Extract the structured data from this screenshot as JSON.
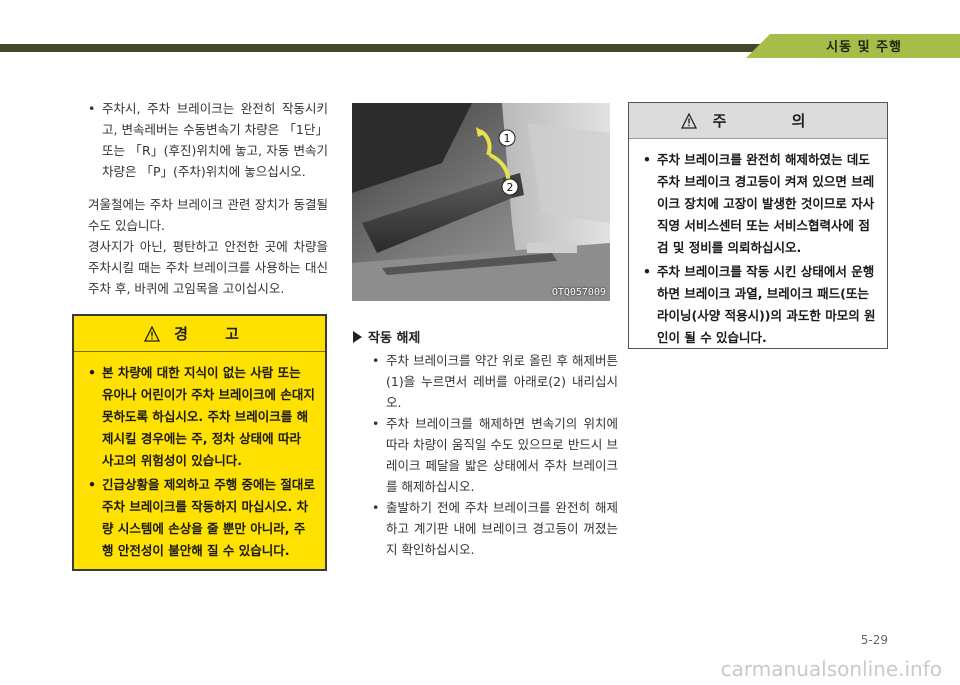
{
  "header": {
    "section_title": "시동 및 주행"
  },
  "left_column": {
    "bullet_parking": "주차시, 주차 브레이크는 완전히 작동시키고, 변속레버는 수동변속기 차량은 「1단」 또는 「R」(후진)위치에 놓고, 자동 변속기차량은 「P」(주차)위치에 놓으십시오.",
    "para_winter": "겨울철에는 주차 브레이크 관련 장치가 동결될 수도 있습니다.",
    "para_slope": "경사지가 아닌, 평탄하고 안전한 곳에 차량을 주차시킬 때는 주차 브레이크를 사용하는 대신 주차 후, 바퀴에 고임목을 고이십시오."
  },
  "warning_box": {
    "title": "경 고",
    "items": [
      "본 차량에 대한 지식이 없는 사람 또는 유아나 어린이가 주차 브레이크에 손대지 못하도록 하십시오. 주차 브레이크를 해제시킬 경우에는 주, 정차 상태에 따라 사고의 위험성이 있습니다.",
      "긴급상황을 제외하고 주행 중에는 절대로 주차 브레이크를 작동하지 마십시오. 차량 시스템에 손상을 줄 뿐만 아니라, 주행 안전성이 불안해 질 수 있습니다."
    ]
  },
  "photo": {
    "code": "OTQ057009",
    "callout_1": "1",
    "callout_2": "2"
  },
  "release_section": {
    "heading": "작동 해제",
    "items": [
      "주차 브레이크를 약간 위로 올린 후 해제버튼(1)을 누르면서 레버를 아래로(2) 내리십시오.",
      "주차 브레이크를 해제하면 변속기의 위치에 따라 차량이 움직일 수도 있으므로 반드시 브레이크 페달을 밟은 상태에서 주차 브레이크를 해제하십시오.",
      "출발하기 전에 주차 브레이크를 완전히 해제하고 계기판 내에 브레이크 경고등이 꺼졌는지 확인하십시오."
    ]
  },
  "caution_box": {
    "title": "주 의",
    "items": [
      "주차 브레이크를 완전히 해제하였는 데도 주차 브레이크 경고등이 켜져 있으면 브레이크 장치에 고장이 발생한 것이므로 자사 직영 서비스센터 또는 서비스협력사에 점검 및 정비를 의뢰하십시오.",
      "주차 브레이크를 작동 시킨 상태에서 운행하면 브레이크 과열, 브레이크 패드(또는 라이닝(사양 적용시))의 과도한 마모의 원인이 될 수 있습니다."
    ]
  },
  "footer": {
    "page_number": "5-29",
    "watermark": "carmanualsonline.info"
  },
  "colors": {
    "header_accent": "#a6bd49",
    "header_dark": "#3f4a2c",
    "warning_fill": "#ffe101",
    "caution_head_fill": "#dcdcdc"
  }
}
